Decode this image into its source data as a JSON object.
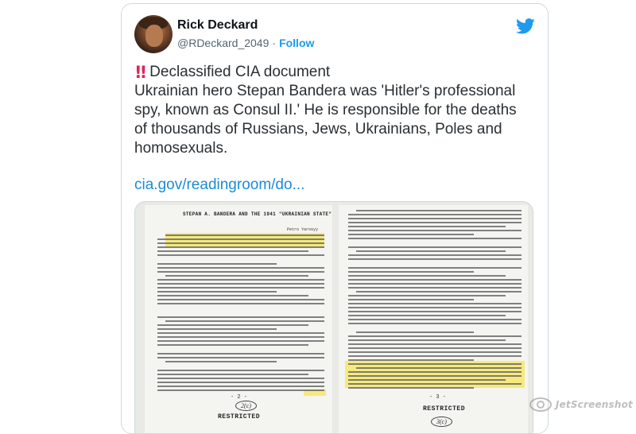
{
  "author": {
    "name": "Rick Deckard",
    "handle": "@RDeckard_2049",
    "separator": "·",
    "follow_label": "Follow"
  },
  "tweet": {
    "marker": "!!",
    "marker_color": "#e0245e",
    "heading": "Declassified CIA document",
    "body": "Ukrainian hero Stepan Bandera was 'Hitler's professional spy, known as Consul II.' He is responsible for the deaths of thousands of Russians, Jews, Ukrainians, Poles and homosexuals.",
    "link": "cia.gov/readingroom/do..."
  },
  "document": {
    "title": "STEPAN A. BANDERA AND THE 1941 \"UKRAINIAN STATE\"",
    "author": "Petro Yarosyy",
    "left_page_number": "- 2 -",
    "right_page_number": "- 3 -",
    "left_handwritten": "2(c)",
    "right_handwritten": "3(c)",
    "stamp": "RESTRICTED",
    "highlight_color": "#f4e66c"
  },
  "icons": {
    "platform": "twitter-bird-icon",
    "watermark": "eye-icon"
  },
  "watermark": {
    "text": "JetScreenshot"
  },
  "colors": {
    "accent": "#1d9bf0",
    "text": "#0f1419",
    "secondary": "#536471"
  }
}
